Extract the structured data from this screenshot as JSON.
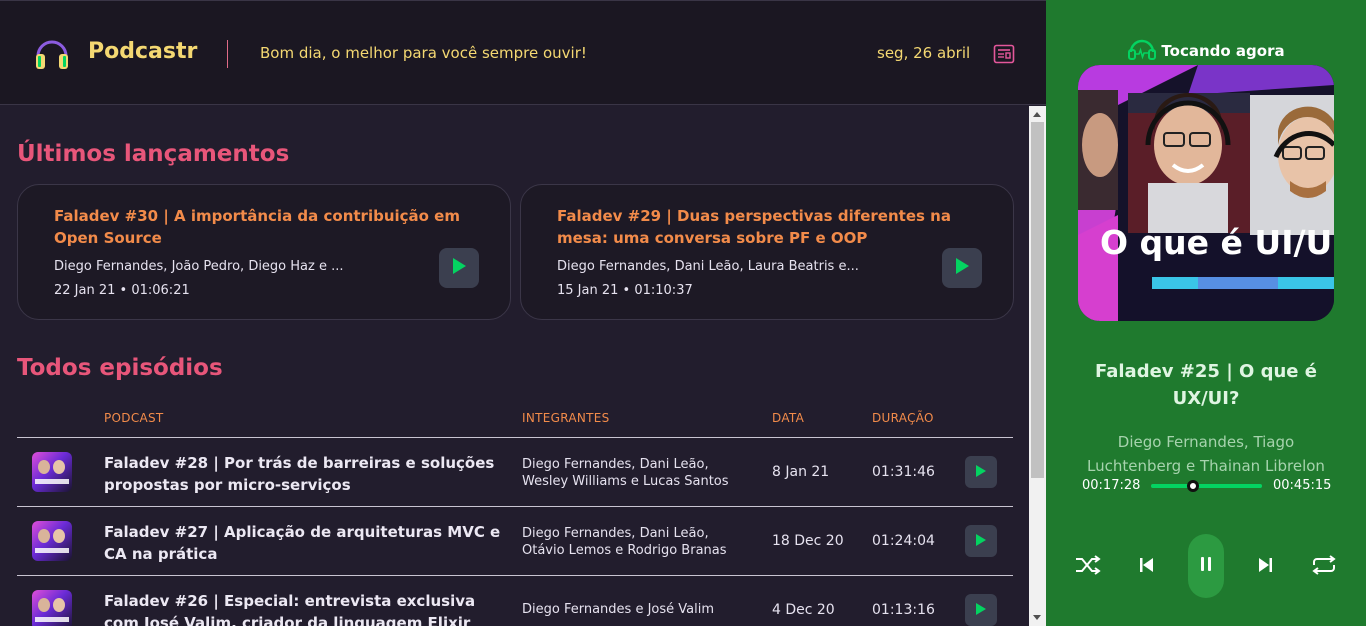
{
  "header": {
    "brand": "Podcastr",
    "tagline": "Bom dia, o melhor para você sempre ouvir!",
    "date": "seg, 26 abril",
    "logo_icon": "headphones-icon",
    "calendar_icon": "newspaper-icon"
  },
  "latest": {
    "title": "Últimos lançamentos",
    "cards": [
      {
        "title": "Faladev #30 | A importância da contribuição em Open Source",
        "members": "Diego Fernandes, João Pedro, Diego Haz e ...",
        "date": "22 Jan 21",
        "duration": "01:06:21",
        "separator": "•"
      },
      {
        "title": "Faladev #29 | Duas perspectivas diferentes na mesa: uma conversa sobre PF e OOP",
        "members": "Diego Fernandes, Dani Leão, Laura Beatris e...",
        "date": "15 Jan 21",
        "duration": "01:10:37",
        "separator": "•"
      }
    ]
  },
  "all": {
    "title": "Todos episódios",
    "columns": [
      "PODCAST",
      "INTEGRANTES",
      "DATA",
      "DURAÇÃO"
    ],
    "rows": [
      {
        "title": "Faladev #28 | Por trás de barreiras e soluções propostas por micro-serviços",
        "members": "Diego Fernandes, Dani Leão, Wesley Williams e Lucas Santos",
        "date": "8 Jan 21",
        "duration": "01:31:46"
      },
      {
        "title": "Faladev #27 | Aplicação de arquiteturas MVC e CA na prática",
        "members": "Diego Fernandes, Dani Leão, Otávio Lemos e Rodrigo Branas",
        "date": "18 Dec 20",
        "duration": "01:24:04"
      },
      {
        "title": "Faladev #26 | Especial: entrevista exclusiva com José Valim, criador da linguagem Elixir",
        "members": "Diego Fernandes e José Valim",
        "date": "4 Dec 20",
        "duration": "01:13:16"
      }
    ]
  },
  "player": {
    "label": "Tocando agora",
    "cover_text": "O que é UI/U",
    "title": "Faladev #25 | O que é UX/UI?",
    "members": "Diego Fernandes, Tiago Luchtenberg e Thainan Librelon",
    "current_time": "00:17:28",
    "total_time": "00:45:15",
    "progress": 0.38
  },
  "colors": {
    "brand_yellow": "#f4d872",
    "section_pink": "#e8567a",
    "accent_orange": "#f28b4a",
    "play_green": "#04d361",
    "player_bg": "#1f7a2e"
  }
}
